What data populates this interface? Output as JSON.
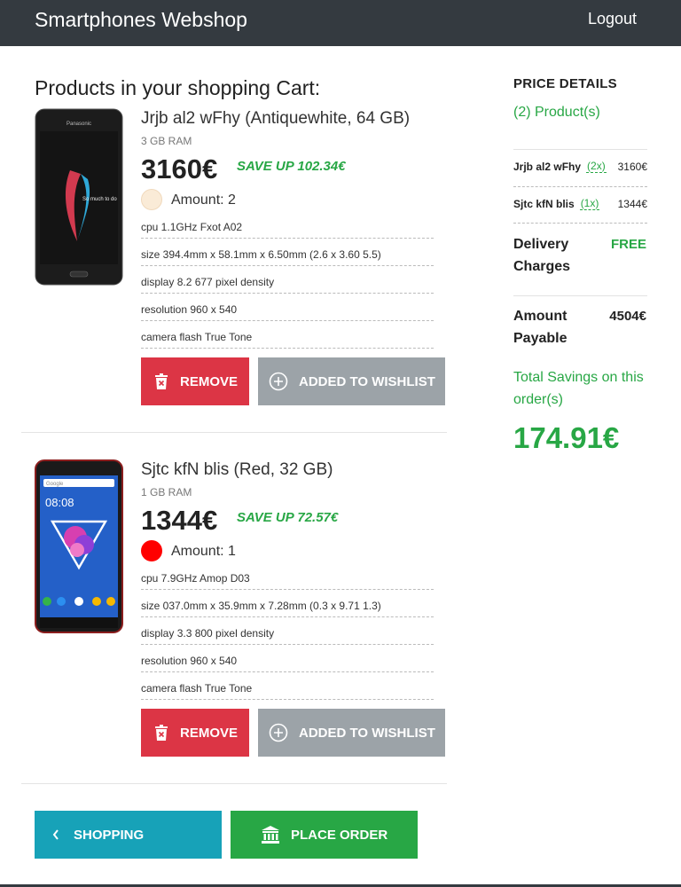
{
  "header": {
    "brand": "Smartphones Webshop",
    "logout_label": "Logout"
  },
  "cart": {
    "title": "Products in your shopping Cart:",
    "remove_label": "REMOVE",
    "wishlist_label": "ADDED TO WISHLIST",
    "amount_prefix": "Amount: ",
    "products": [
      {
        "name": "Jrjb al2 wFhy (Antiquewhite, 64 GB)",
        "ram": "3 GB RAM",
        "price": "3160€",
        "savings": "SAVE UP 102.34€",
        "color": "#faebd7",
        "amount": "2",
        "specs": [
          "cpu 1.1GHz Fxot A02",
          "size 394.4mm x 58.1mm x 6.50mm (2.6 x 3.60 5.5)",
          "display 8.2 677 pixel density",
          "resolution 960 x 540",
          "camera flash True Tone"
        ]
      },
      {
        "name": "Sjtc kfN blis (Red, 32 GB)",
        "ram": "1 GB RAM",
        "price": "1344€",
        "savings": "SAVE UP 72.57€",
        "color": "#ff0000",
        "amount": "1",
        "specs": [
          "cpu 7.9GHz Amop D03",
          "size 037.0mm x 35.9mm x 7.28mm (0.3 x 9.71 1.3)",
          "display 3.3 800 pixel density",
          "resolution 960 x 540",
          "camera flash True Tone"
        ]
      }
    ],
    "shopping_label": "SHOPPING",
    "place_order_label": "PLACE ORDER"
  },
  "price_details": {
    "title": "PRICE DETAILS",
    "product_count": "(2) Product(s)",
    "items": [
      {
        "name": "Jrjb al2 wFhy",
        "qty": "(2x)",
        "price": "3160€"
      },
      {
        "name": "Sjtc kfN blis",
        "qty": "(1x)",
        "price": "1344€"
      }
    ],
    "delivery_label_1": "Delivery",
    "delivery_label_2": "Charges",
    "delivery_value": "FREE",
    "amount_label_1": "Amount",
    "amount_label_2": "Payable",
    "amount_value": "4504€",
    "savings_label": "Total Savings on this order(s)",
    "savings_value": "174.91€"
  },
  "phone_screen": {
    "brand_text": "Panasonic",
    "lock_text": "So much to do",
    "search_label": "Google",
    "clock": "08:08"
  },
  "colors": {
    "navbar": "#343a40",
    "remove": "#dc3545",
    "wishlist": "#9ca3a8",
    "shopping": "#17a2b8",
    "order": "#28a745",
    "accent_green": "#28a745"
  },
  "icons": {
    "remove": "trash-icon",
    "wishlist": "plus-circle-icon",
    "shopping": "chevron-left-icon",
    "order": "bank-icon"
  }
}
